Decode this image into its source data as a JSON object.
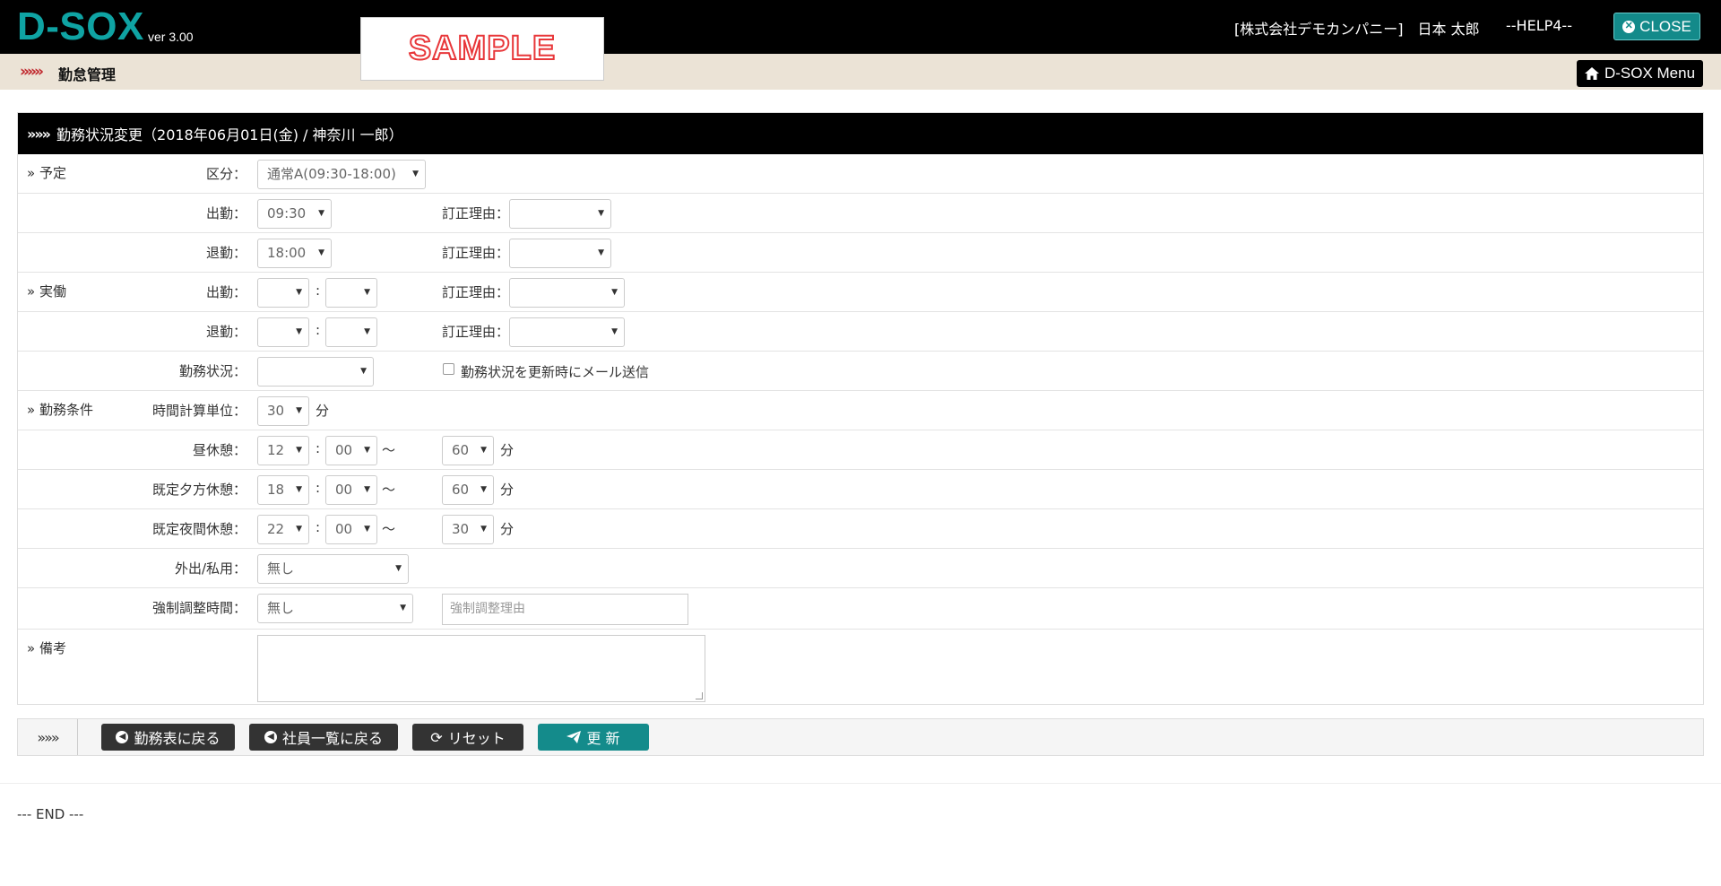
{
  "app": {
    "logo": "D-SOX",
    "version": "ver 3.00",
    "sample": "SAMPLE",
    "company_user": "[株式会社デモカンパニー]　日本 太郎",
    "help": "--HELP4--",
    "close_label": "CLOSE"
  },
  "subbar": {
    "marker": "»»»",
    "title": "勤怠管理",
    "menu_label": "D-SOX Menu"
  },
  "panel": {
    "marker": "»»»",
    "title": "勤務状況変更（2018年06月01日(金) / 神奈川 一郎）"
  },
  "form": {
    "sections": {
      "yotei": "» 予定",
      "jitsudo": "» 実働",
      "joken": "» 勤務条件",
      "biko": "» 備考"
    },
    "labels": {
      "kubun": "区分：",
      "shukkin": "出勤：",
      "taikin": "退勤：",
      "teisei": "訂正理由：",
      "kinmu_jokyo": "勤務状況：",
      "jikan_tani": "時間計算単位：",
      "hiru_kyukei": "昼休憩：",
      "yugata_kyukei": "既定夕方休憩：",
      "yakan_kyukei": "既定夜間休憩：",
      "gaishutsu": "外出/私用：",
      "kyosei": "強制調整時間："
    },
    "values": {
      "kubun": "通常A(09:30-18:00)",
      "yotei_shukkin": "09:30",
      "yotei_taikin": "18:00",
      "jikan_tani": "30",
      "hiru_h": "12",
      "hiru_m": "00",
      "hiru_len": "60",
      "yugata_h": "18",
      "yugata_m": "00",
      "yugata_len": "60",
      "yakan_h": "22",
      "yakan_m": "00",
      "yakan_len": "30",
      "gaishutsu": "無し",
      "kyosei": "無し"
    },
    "mail_checkbox_label": "勤務状況を更新時にメール送信",
    "kyosei_reason_placeholder": "強制調整理由",
    "unit_min": "分",
    "tilde": "〜",
    "colon": ":"
  },
  "buttons": {
    "marker": "»»»",
    "back_schedule": "勤務表に戻る",
    "back_list": "社員一覧に戻る",
    "reset": "リセット",
    "update": "更 新"
  },
  "footer": {
    "end": "--- END ---"
  }
}
